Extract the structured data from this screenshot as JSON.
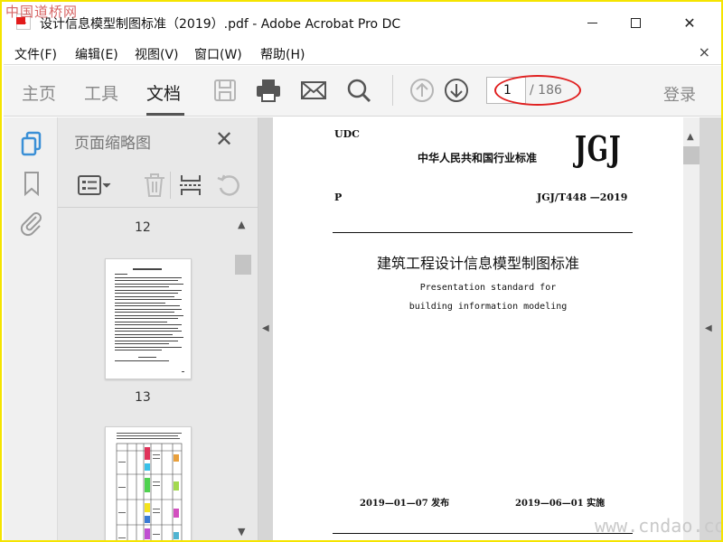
{
  "watermark": {
    "top_left": "中国道桥网",
    "bottom_right": "www.cndao.com"
  },
  "window": {
    "title": "设计信息模型制图标准（2019）.pdf - Adobe Acrobat Pro DC",
    "minimize_icon": "minimize-icon",
    "maximize_icon": "maximize-icon",
    "close_icon": "close-icon"
  },
  "menu": {
    "items": [
      "文件(F)",
      "编辑(E)",
      "视图(V)",
      "窗口(W)",
      "帮助(H)"
    ],
    "close_symbol": "×"
  },
  "toolbar": {
    "tabs": [
      "主页",
      "工具",
      "文档"
    ],
    "active_tab": "文档",
    "icons": [
      "save-icon",
      "print-icon",
      "email-icon",
      "search-icon",
      "page-up-icon",
      "page-down-icon"
    ],
    "page_current": "1",
    "page_total": "/ 186",
    "login_label": "登录"
  },
  "left_nav": {
    "icons": [
      "page-thumbnails-icon",
      "bookmark-icon",
      "attachment-icon"
    ]
  },
  "thumbnail_panel": {
    "title": "页面缩略图",
    "close_symbol": "✕",
    "tools": [
      "thumbnail-options-icon",
      "delete-icon",
      "extract-icon",
      "rotate-icon"
    ],
    "pages": [
      "12",
      "13"
    ]
  },
  "document": {
    "udc": "UDC",
    "org": "中华人民共和国行业标准",
    "series": "JGJ",
    "p": "P",
    "code": "JGJ/T448  —2019",
    "title_cn": "建筑工程设计信息模型制图标准",
    "title_en_1": "Presentation standard for",
    "title_en_2": "building information modeling",
    "publish_date": "2019—01—07  发布",
    "implement_date": "2019—06—01  实施"
  },
  "colors": {
    "frame_border": "#f5e400",
    "annotation": "#e02020",
    "toolbar_bg": "#f4f4f4",
    "panel_bg": "#e8e8e8",
    "icon_blue": "#3a8fd6"
  }
}
